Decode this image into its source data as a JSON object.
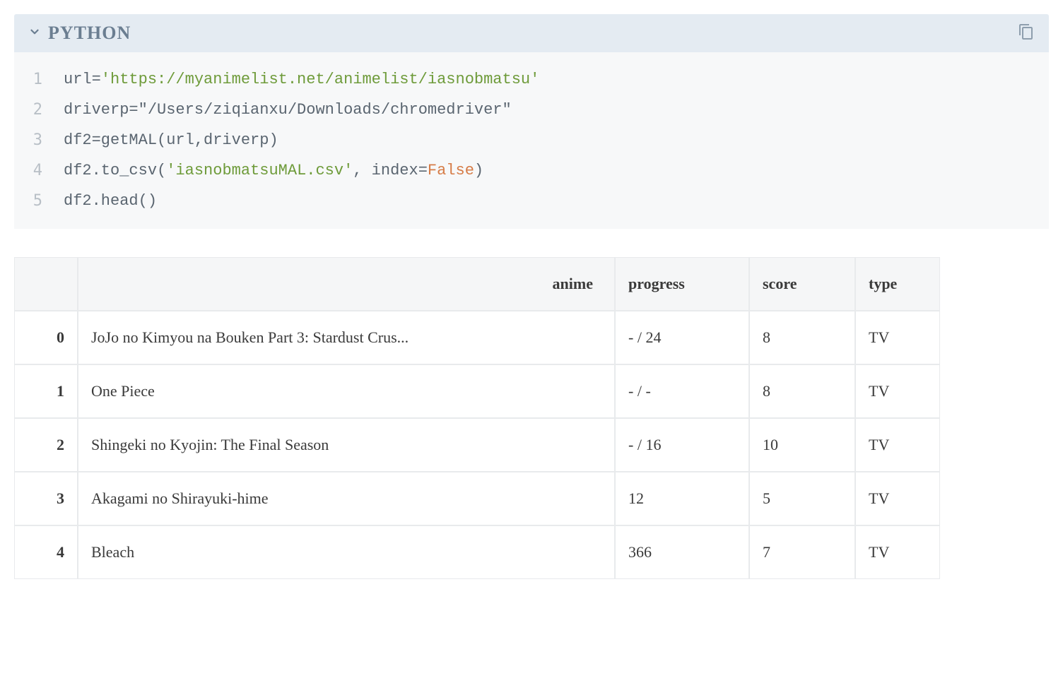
{
  "code_cell": {
    "language": "PYTHON",
    "lines": [
      {
        "n": "1",
        "tokens": [
          {
            "t": "url=",
            "c": "plain"
          },
          {
            "t": "'https://myanimelist.net/animelist/iasnobmatsu'",
            "c": "str"
          }
        ]
      },
      {
        "n": "2",
        "tokens": [
          {
            "t": "driverp=",
            "c": "plain"
          },
          {
            "t": "\"/Users/ziqianxu/Downloads/chromedriver\"",
            "c": "str2"
          }
        ]
      },
      {
        "n": "3",
        "tokens": [
          {
            "t": "df2=getMAL(url,driverp)",
            "c": "plain"
          }
        ]
      },
      {
        "n": "4",
        "tokens": [
          {
            "t": "df2.to_csv(",
            "c": "plain"
          },
          {
            "t": "'iasnobmatsuMAL.csv'",
            "c": "str"
          },
          {
            "t": ", index=",
            "c": "plain"
          },
          {
            "t": "False",
            "c": "kw"
          },
          {
            "t": ")",
            "c": "plain"
          }
        ]
      },
      {
        "n": "5",
        "tokens": [
          {
            "t": "df2.head()",
            "c": "plain"
          }
        ]
      }
    ]
  },
  "output": {
    "columns": [
      "anime",
      "progress",
      "score",
      "type"
    ],
    "rows": [
      {
        "idx": "0",
        "anime": "JoJo no Kimyou na Bouken Part 3: Stardust Crus...",
        "progress": "- / 24",
        "score": "8",
        "type": "TV"
      },
      {
        "idx": "1",
        "anime": "One Piece",
        "progress": "- / -",
        "score": "8",
        "type": "TV"
      },
      {
        "idx": "2",
        "anime": "Shingeki no Kyojin: The Final Season",
        "progress": "- / 16",
        "score": "10",
        "type": "TV"
      },
      {
        "idx": "3",
        "anime": "Akagami no Shirayuki-hime",
        "progress": "12",
        "score": "5",
        "type": "TV"
      },
      {
        "idx": "4",
        "anime": "Bleach",
        "progress": "366",
        "score": "7",
        "type": "TV"
      }
    ]
  }
}
